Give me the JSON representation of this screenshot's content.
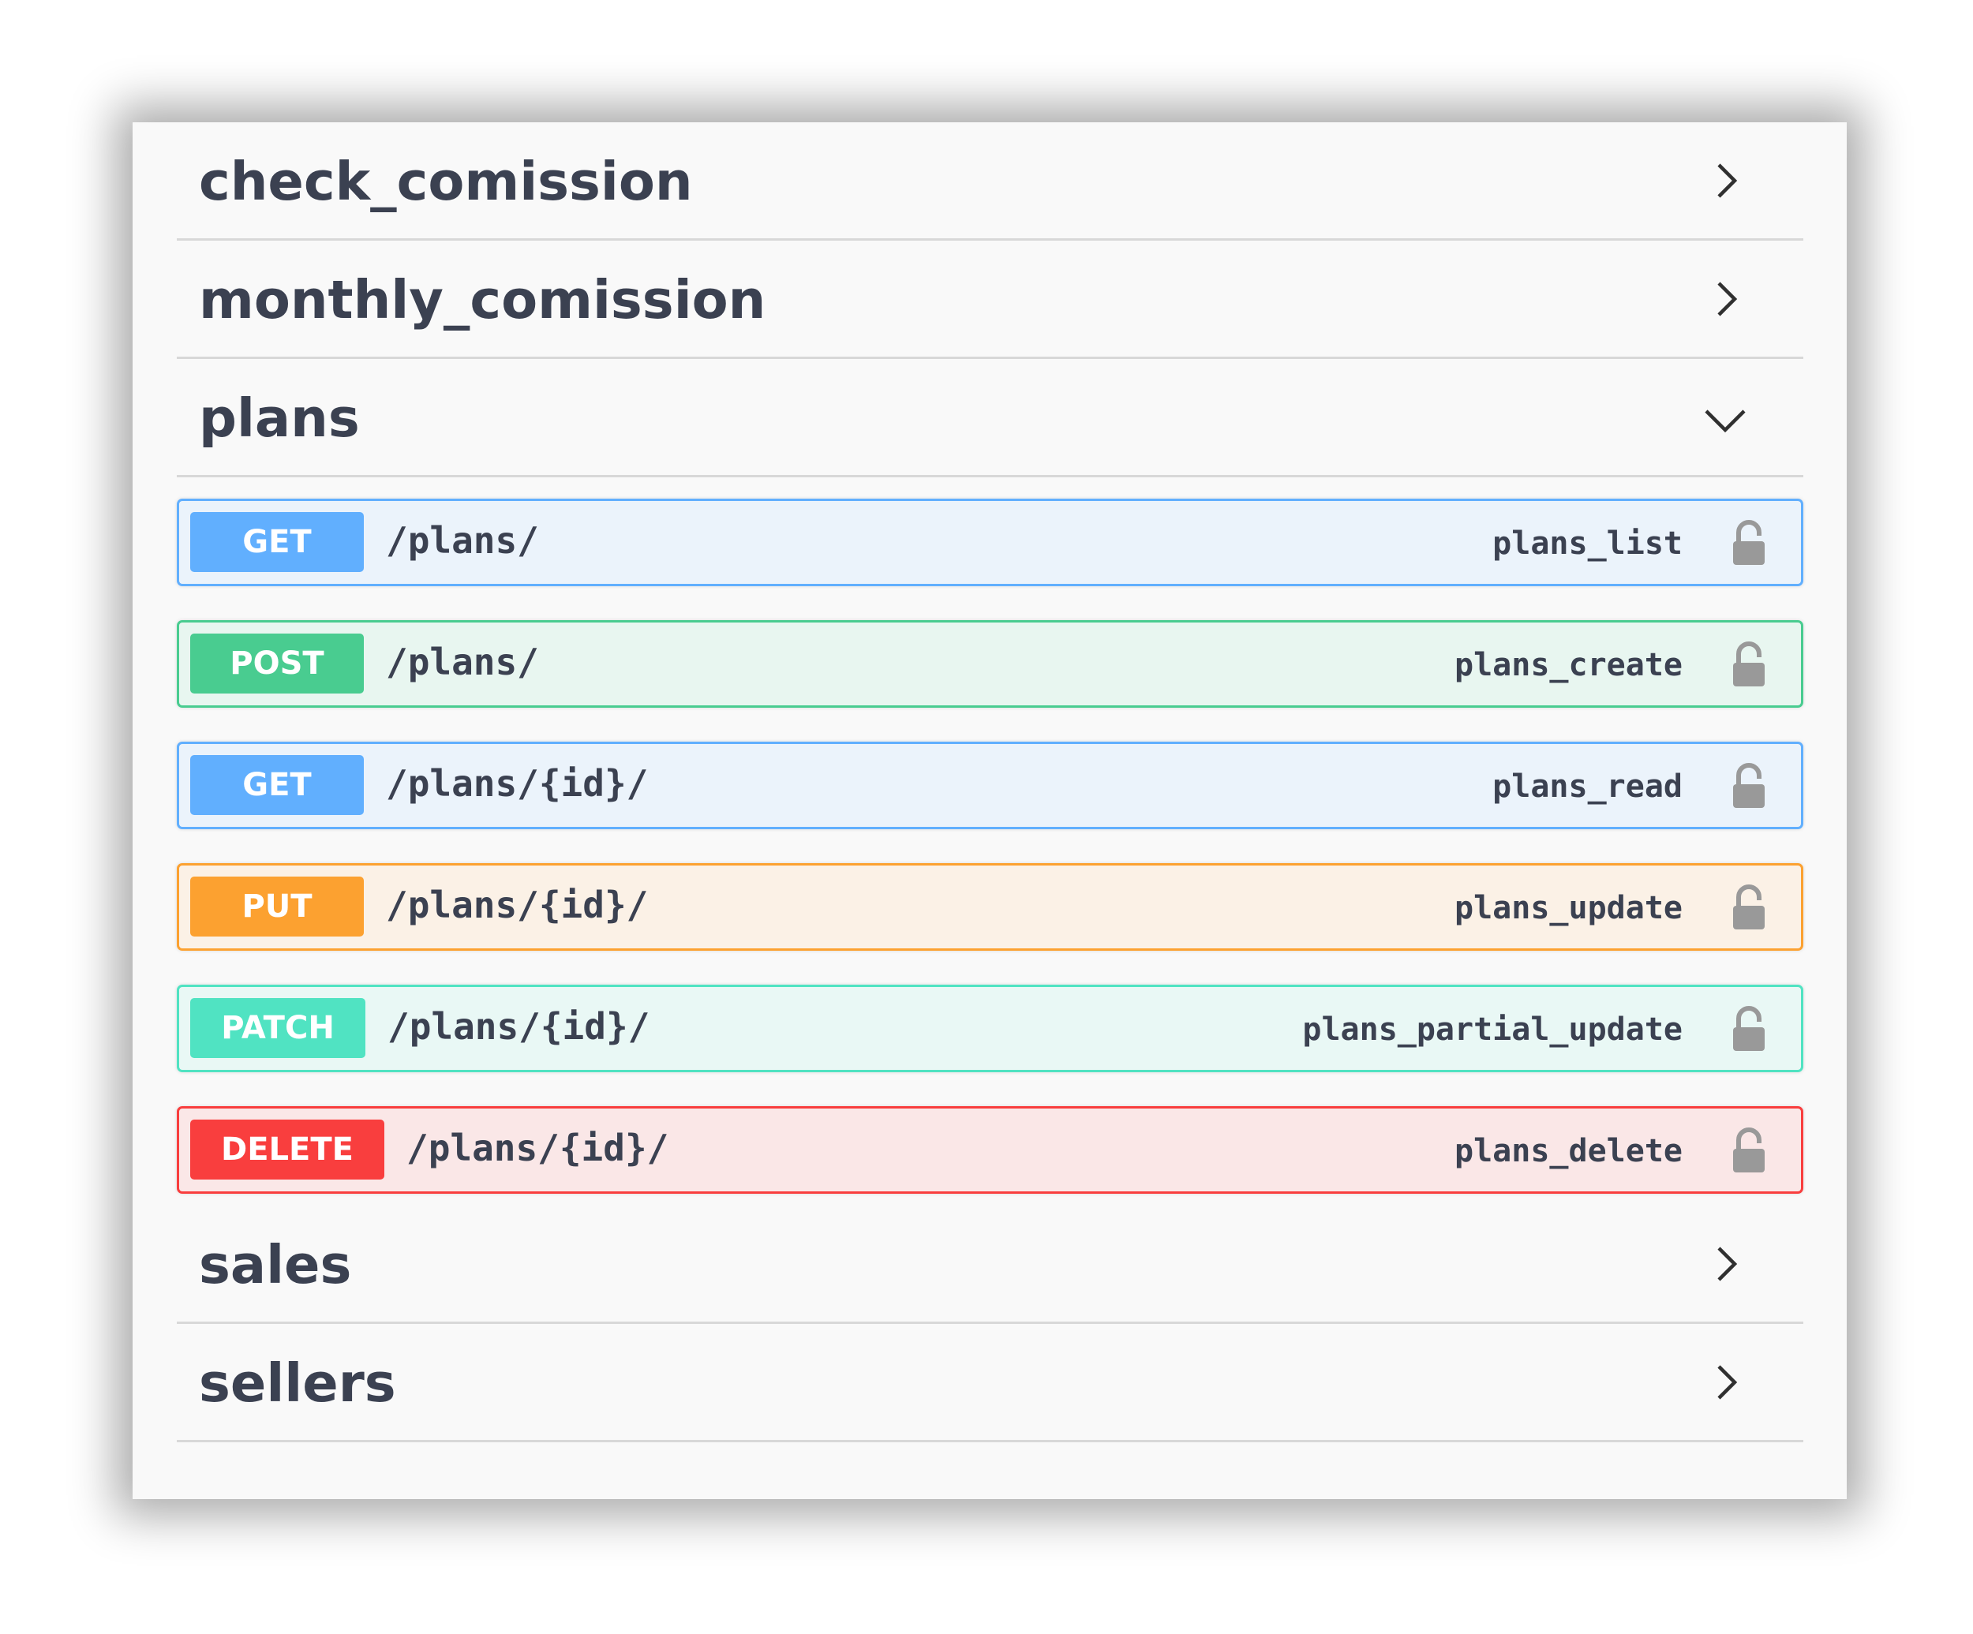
{
  "tags": [
    {
      "name": "check_comission",
      "expanded": false,
      "icon": "chevron-right-icon"
    },
    {
      "name": "monthly_comission",
      "expanded": false,
      "icon": "chevron-right-icon"
    },
    {
      "name": "plans",
      "expanded": true,
      "icon": "chevron-down-icon"
    },
    {
      "name": "sales",
      "expanded": false,
      "icon": "chevron-right-icon"
    },
    {
      "name": "sellers",
      "expanded": false,
      "icon": "chevron-right-icon"
    }
  ],
  "operations": [
    {
      "method": "GET",
      "path": "/plans/",
      "operation_id": "plans_list",
      "color": "#61affe",
      "lock_icon": "lock-icon"
    },
    {
      "method": "POST",
      "path": "/plans/",
      "operation_id": "plans_create",
      "color": "#49cc90",
      "lock_icon": "lock-icon"
    },
    {
      "method": "GET",
      "path": "/plans/{id}/",
      "operation_id": "plans_read",
      "color": "#61affe",
      "lock_icon": "lock-icon"
    },
    {
      "method": "PUT",
      "path": "/plans/{id}/",
      "operation_id": "plans_update",
      "color": "#fca130",
      "lock_icon": "lock-icon"
    },
    {
      "method": "PATCH",
      "path": "/plans/{id}/",
      "operation_id": "plans_partial_update",
      "color": "#50e3c2",
      "lock_icon": "lock-icon"
    },
    {
      "method": "DELETE",
      "path": "/plans/{id}/",
      "operation_id": "plans_delete",
      "color": "#f93e3e",
      "lock_icon": "lock-icon"
    }
  ],
  "colors": {
    "text": "#3b4151",
    "divider": "#d8d8d8",
    "lock": "#999999"
  }
}
